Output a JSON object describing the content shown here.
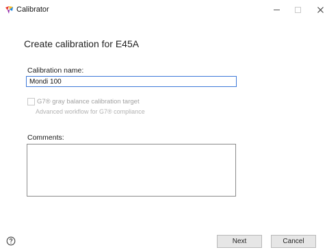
{
  "window": {
    "title": "Calibrator",
    "icon": "palette-icon",
    "controls": [
      "minimize-icon",
      "maximize-icon",
      "close-icon"
    ]
  },
  "dialog": {
    "heading": "Create calibration for E45A",
    "name_label": "Calibration name:",
    "name_value": "Mondi 100",
    "g7_label": "G7® gray balance calibration target",
    "g7_sublabel": "Advanced workflow for G7® compliance",
    "g7_checked": false,
    "comments_label": "Comments:",
    "comments_value": ""
  },
  "footer": {
    "help_icon": "help-icon",
    "next_label": "Next",
    "cancel_label": "Cancel"
  },
  "colors": {
    "input_focus_border": "#3c78d8",
    "disabled_text": "#a0a0a0",
    "button_bg": "#e6e6e6"
  }
}
